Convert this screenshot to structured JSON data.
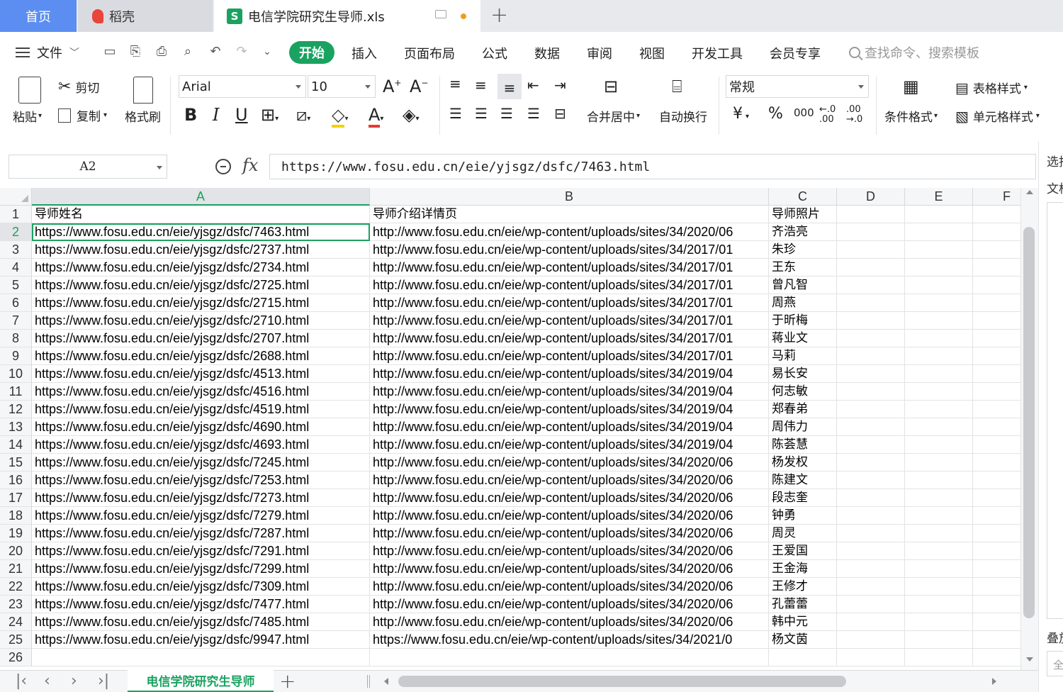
{
  "tabs": {
    "home": "首页",
    "daoke": "稻壳",
    "file": "电信学院研究生导师.xls",
    "file_icon": "S"
  },
  "menu": {
    "file": "文件",
    "items": [
      "开始",
      "插入",
      "页面布局",
      "公式",
      "数据",
      "审阅",
      "视图",
      "开发工具",
      "会员专享"
    ],
    "search": "查找命令、搜索模板"
  },
  "ribbon": {
    "paste": "粘贴",
    "cut": "剪切",
    "copy": "复制",
    "format_painter": "格式刷",
    "font": "Arial",
    "size": "10",
    "merge_center": "合并居中",
    "wrap": "自动换行",
    "number_format": "常规",
    "conditional": "条件格式",
    "table_style": "表格样式",
    "cell_style": "单元格样式",
    "yen": "¥",
    "percent": "%",
    "thousand": "000"
  },
  "formula_bar": {
    "name_box": "A2",
    "fx": "fx",
    "value": "https://www.fosu.edu.cn/eie/yjsgz/dsfc/7463.html"
  },
  "side_pane": {
    "t1": "选择",
    "t2": "文档",
    "t3": "叠放",
    "t4": "全"
  },
  "grid": {
    "columns": [
      "A",
      "B",
      "C",
      "D",
      "E",
      "F"
    ],
    "headers": [
      "导师姓名",
      "导师介绍详情页",
      "导师照片"
    ],
    "rows": [
      [
        "https://www.fosu.edu.cn/eie/yjsgz/dsfc/7463.html",
        "http://www.fosu.edu.cn/eie/wp-content/uploads/sites/34/2020/06",
        "齐浩亮"
      ],
      [
        "https://www.fosu.edu.cn/eie/yjsgz/dsfc/2737.html",
        "http://www.fosu.edu.cn/eie/wp-content/uploads/sites/34/2017/01",
        "朱珍"
      ],
      [
        "https://www.fosu.edu.cn/eie/yjsgz/dsfc/2734.html",
        "http://www.fosu.edu.cn/eie/wp-content/uploads/sites/34/2017/01",
        "王东"
      ],
      [
        "https://www.fosu.edu.cn/eie/yjsgz/dsfc/2725.html",
        "http://www.fosu.edu.cn/eie/wp-content/uploads/sites/34/2017/01",
        "曾凡智"
      ],
      [
        "https://www.fosu.edu.cn/eie/yjsgz/dsfc/2715.html",
        "http://www.fosu.edu.cn/eie/wp-content/uploads/sites/34/2017/01",
        "周燕"
      ],
      [
        "https://www.fosu.edu.cn/eie/yjsgz/dsfc/2710.html",
        "http://www.fosu.edu.cn/eie/wp-content/uploads/sites/34/2017/01",
        "于昕梅"
      ],
      [
        "https://www.fosu.edu.cn/eie/yjsgz/dsfc/2707.html",
        "http://www.fosu.edu.cn/eie/wp-content/uploads/sites/34/2017/01",
        "蒋业文"
      ],
      [
        "https://www.fosu.edu.cn/eie/yjsgz/dsfc/2688.html",
        "http://www.fosu.edu.cn/eie/wp-content/uploads/sites/34/2017/01",
        "马莉"
      ],
      [
        "https://www.fosu.edu.cn/eie/yjsgz/dsfc/4513.html",
        "http://www.fosu.edu.cn/eie/wp-content/uploads/sites/34/2019/04",
        "易长安"
      ],
      [
        "https://www.fosu.edu.cn/eie/yjsgz/dsfc/4516.html",
        "http://www.fosu.edu.cn/eie/wp-content/uploads/sites/34/2019/04",
        "何志敏"
      ],
      [
        "https://www.fosu.edu.cn/eie/yjsgz/dsfc/4519.html",
        "http://www.fosu.edu.cn/eie/wp-content/uploads/sites/34/2019/04",
        "郑春弟"
      ],
      [
        "https://www.fosu.edu.cn/eie/yjsgz/dsfc/4690.html",
        "http://www.fosu.edu.cn/eie/wp-content/uploads/sites/34/2019/04",
        "周伟力"
      ],
      [
        "https://www.fosu.edu.cn/eie/yjsgz/dsfc/4693.html",
        "http://www.fosu.edu.cn/eie/wp-content/uploads/sites/34/2019/04",
        "陈荟慧"
      ],
      [
        "https://www.fosu.edu.cn/eie/yjsgz/dsfc/7245.html",
        "http://www.fosu.edu.cn/eie/wp-content/uploads/sites/34/2020/06",
        "杨发权"
      ],
      [
        "https://www.fosu.edu.cn/eie/yjsgz/dsfc/7253.html",
        "http://www.fosu.edu.cn/eie/wp-content/uploads/sites/34/2020/06",
        "陈建文"
      ],
      [
        "https://www.fosu.edu.cn/eie/yjsgz/dsfc/7273.html",
        "http://www.fosu.edu.cn/eie/wp-content/uploads/sites/34/2020/06",
        "段志奎"
      ],
      [
        "https://www.fosu.edu.cn/eie/yjsgz/dsfc/7279.html",
        "http://www.fosu.edu.cn/eie/wp-content/uploads/sites/34/2020/06",
        "钟勇"
      ],
      [
        "https://www.fosu.edu.cn/eie/yjsgz/dsfc/7287.html",
        "http://www.fosu.edu.cn/eie/wp-content/uploads/sites/34/2020/06",
        "周灵"
      ],
      [
        "https://www.fosu.edu.cn/eie/yjsgz/dsfc/7291.html",
        "http://www.fosu.edu.cn/eie/wp-content/uploads/sites/34/2020/06",
        "王爱国"
      ],
      [
        "https://www.fosu.edu.cn/eie/yjsgz/dsfc/7299.html",
        "http://www.fosu.edu.cn/eie/wp-content/uploads/sites/34/2020/06",
        "王金海"
      ],
      [
        "https://www.fosu.edu.cn/eie/yjsgz/dsfc/7309.html",
        "http://www.fosu.edu.cn/eie/wp-content/uploads/sites/34/2020/06",
        "王修才"
      ],
      [
        "https://www.fosu.edu.cn/eie/yjsgz/dsfc/7477.html",
        "http://www.fosu.edu.cn/eie/wp-content/uploads/sites/34/2020/06",
        "孔蕾蕾"
      ],
      [
        "https://www.fosu.edu.cn/eie/yjsgz/dsfc/7485.html",
        "http://www.fosu.edu.cn/eie/wp-content/uploads/sites/34/2020/06",
        "韩中元"
      ],
      [
        "https://www.fosu.edu.cn/eie/yjsgz/dsfc/9947.html",
        "https://www.fosu.edu.cn/eie/wp-content/uploads/sites/34/2021/0",
        "杨文茵"
      ]
    ],
    "row_numbers": [
      "1",
      "2",
      "3",
      "4",
      "5",
      "6",
      "7",
      "8",
      "9",
      "10",
      "11",
      "12",
      "13",
      "14",
      "15",
      "16",
      "17",
      "18",
      "19",
      "20",
      "21",
      "22",
      "23",
      "24",
      "25",
      "26"
    ]
  },
  "sheet": {
    "name": "电信学院研究生导师"
  },
  "colors": {
    "accent": "#1aa260",
    "home_tab": "#5b8ef0"
  }
}
